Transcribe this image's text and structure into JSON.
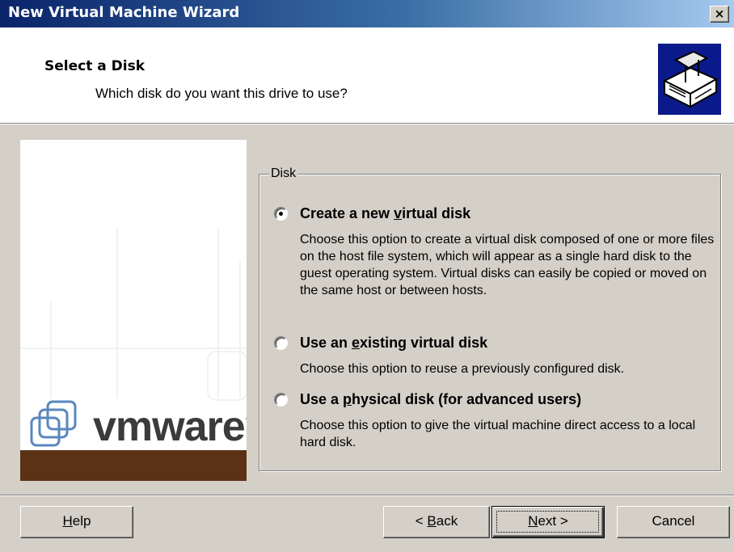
{
  "window": {
    "title": "New Virtual Machine Wizard",
    "close_label": "×"
  },
  "header": {
    "title": "Select a Disk",
    "subtitle": "Which disk do you want this drive to use?",
    "icon": "disk-drive-icon"
  },
  "side_bitmap": {
    "logo_text": "vmware",
    "logo_tm": "™",
    "band_color": "#5b3216"
  },
  "disk_group": {
    "legend": "Disk",
    "selected_index": 0,
    "options": [
      {
        "label_pre": "Create a new ",
        "label_accel": "v",
        "label_post": "irtual disk",
        "desc": "Choose this option to create a virtual disk composed of one or more files on the host file system, which will appear as a single hard disk to the guest operating system. Virtual disks can easily be copied or moved on the same host or between hosts."
      },
      {
        "label_pre": "Use an ",
        "label_accel": "e",
        "label_post": "xisting virtual disk",
        "desc": "Choose this option to reuse a previously configured disk."
      },
      {
        "label_pre": "Use a ",
        "label_accel": "p",
        "label_post": "hysical disk (for advanced users)",
        "desc": "Choose this option to give the virtual machine direct access to a local hard disk."
      }
    ]
  },
  "buttons": {
    "help_accel": "H",
    "help_rest": "elp",
    "back_pre": "< ",
    "back_accel": "B",
    "back_rest": "ack",
    "next_accel": "N",
    "next_rest": "ext >",
    "cancel": "Cancel"
  },
  "colors": {
    "title_gradient_start": "#0a246a",
    "title_gradient_end": "#a6caf0",
    "dialog_face": "#d4d0c8",
    "header_icon_bg": "#0a1a8a"
  }
}
